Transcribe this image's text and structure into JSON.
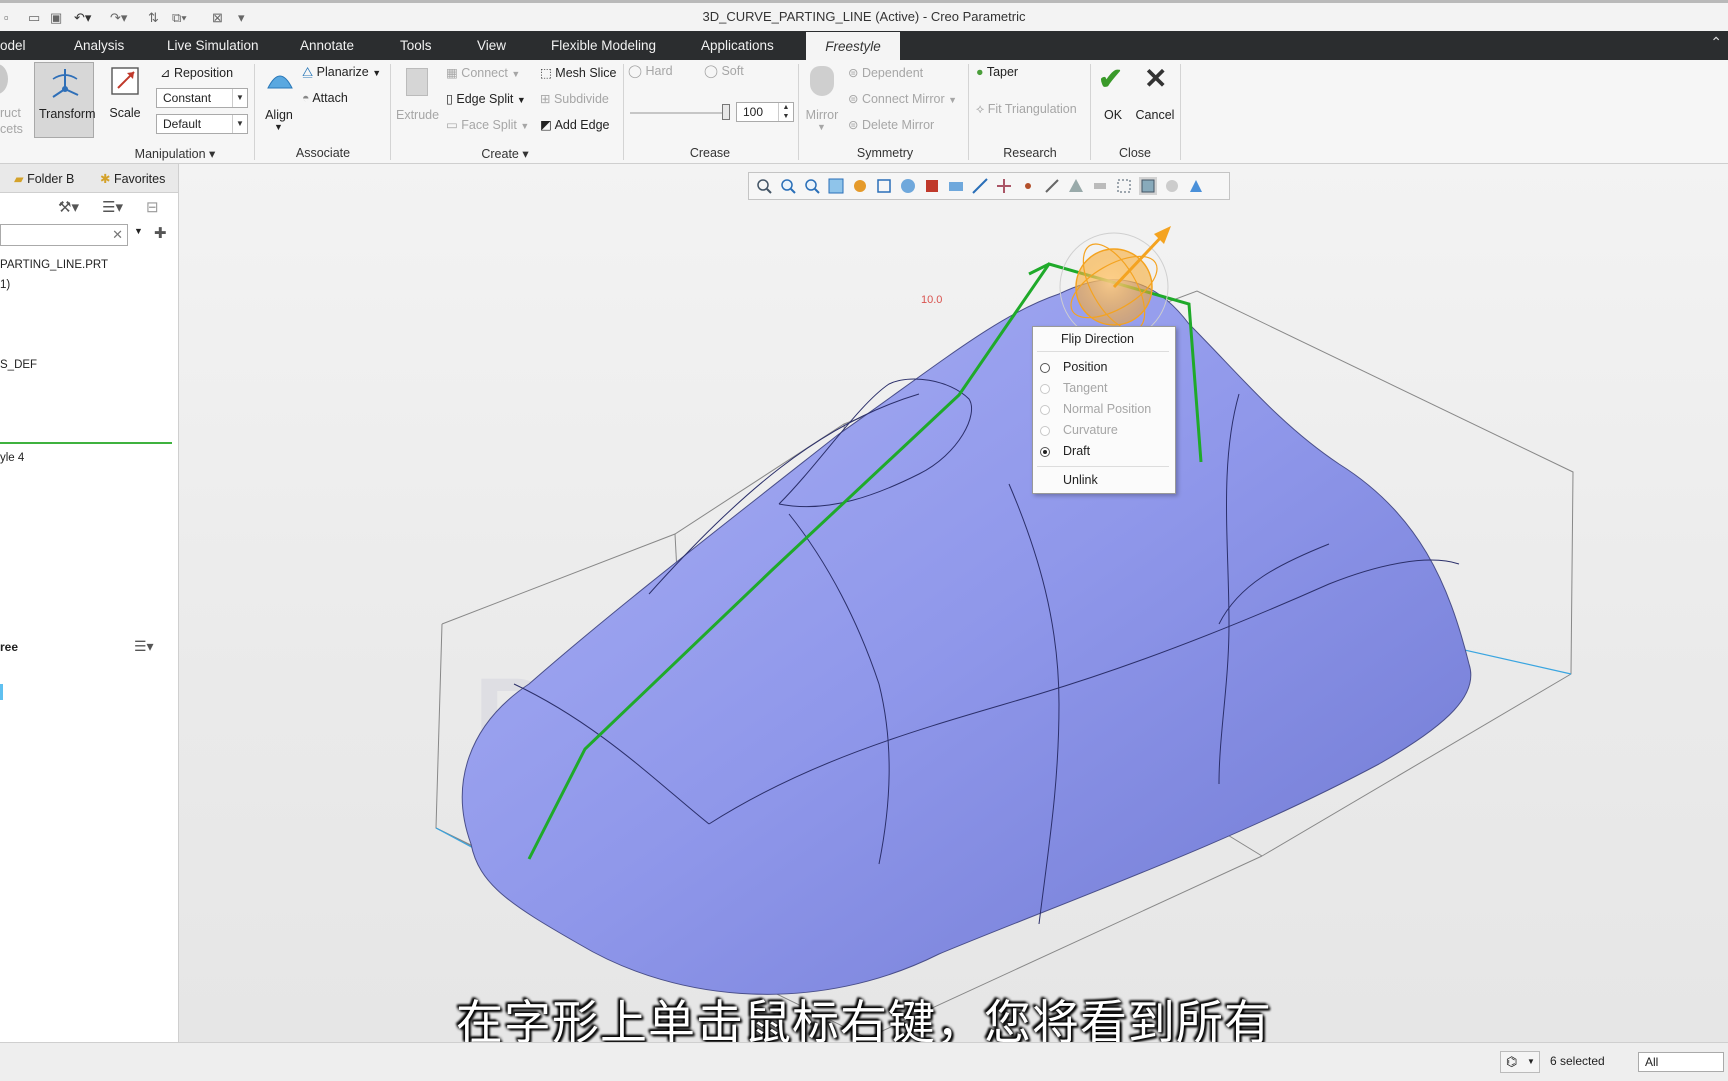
{
  "window": {
    "title": "3D_CURVE_PARTING_LINE (Active) - Creo Parametric"
  },
  "tabs": [
    {
      "label": "odel"
    },
    {
      "label": "Analysis"
    },
    {
      "label": "Live Simulation"
    },
    {
      "label": "Annotate"
    },
    {
      "label": "Tools"
    },
    {
      "label": "View"
    },
    {
      "label": "Flexible Modeling"
    },
    {
      "label": "Applications"
    },
    {
      "label": "Freestyle"
    }
  ],
  "ribbon": {
    "construct_partial": "ruct",
    "construct_partial2": "cets",
    "transform": "Transform",
    "scale": "Scale",
    "reposition": "Reposition",
    "constant": "Constant",
    "default": "Default",
    "manipulation": "Manipulation",
    "align": "Align",
    "planarize": "Planarize",
    "attach": "Attach",
    "associate": "Associate",
    "extrude": "Extrude",
    "connect": "Connect",
    "edge_split": "Edge Split",
    "face_split": "Face Split",
    "mesh_slice": "Mesh Slice",
    "subdivide": "Subdivide",
    "add_edge": "Add Edge",
    "create": "Create",
    "hard": "Hard",
    "soft": "Soft",
    "crease_value": "100",
    "crease": "Crease",
    "mirror": "Mirror",
    "dependent": "Dependent",
    "connect_mirror": "Connect Mirror",
    "delete_mirror": "Delete Mirror",
    "symmetry": "Symmetry",
    "taper": "Taper",
    "fit_triangulation": "Fit Triangulation",
    "research": "Research",
    "ok": "OK",
    "cancel": "Cancel",
    "close": "Close"
  },
  "left_panel": {
    "tab_folder": "Folder B",
    "tab_favorites": "Favorites",
    "tree_items": [
      "PARTING_LINE.PRT",
      "1)",
      "S_DEF",
      "yle 4"
    ],
    "section_title": "ree"
  },
  "context_menu": {
    "items": [
      {
        "label": "Flip Direction",
        "type": "header"
      },
      {
        "label": "Position",
        "type": "radio",
        "enabled": true,
        "selected": false
      },
      {
        "label": "Tangent",
        "type": "radio",
        "enabled": false,
        "selected": false
      },
      {
        "label": "Normal Position",
        "type": "radio",
        "enabled": false,
        "selected": false
      },
      {
        "label": "Curvature",
        "type": "radio",
        "enabled": false,
        "selected": false
      },
      {
        "label": "Draft",
        "type": "radio",
        "enabled": true,
        "selected": true
      },
      {
        "label": "Unlink",
        "type": "item"
      }
    ]
  },
  "viewport": {
    "watermark": "PTC   CHINA",
    "dim_label": "10.0"
  },
  "status": {
    "selected": "6 selected",
    "filter": "All"
  },
  "subtitle": "在字形上单击鼠标右键，您将看到所有",
  "colors": {
    "surface": "#8f97ea",
    "curve": "#1faa2a",
    "dragger": "#f4a320",
    "tab_bar": "#2b2d2f"
  }
}
